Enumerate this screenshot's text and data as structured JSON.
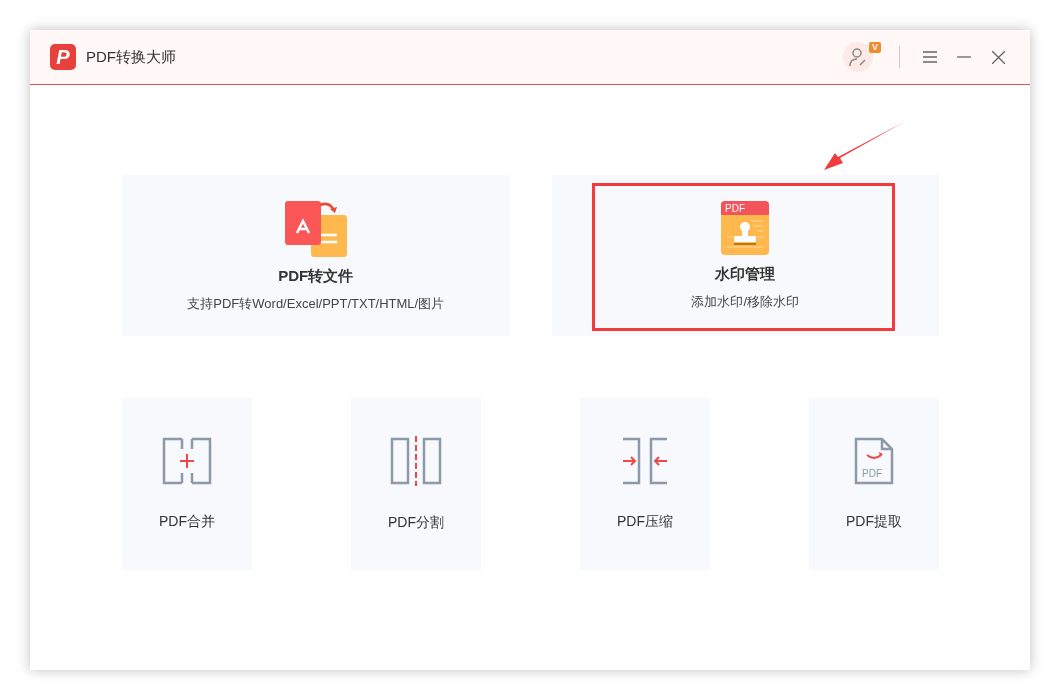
{
  "window": {
    "title": "PDF转换大师",
    "logo_letter": "P",
    "badge": "V"
  },
  "features": [
    {
      "kind": "convert",
      "title": "PDF转文件",
      "subtitle": "支持PDF转Word/Excel/PPT/TXT/HTML/图片",
      "highlighted": false
    },
    {
      "kind": "watermark",
      "title": "水印管理",
      "subtitle": "添加水印/移除水印",
      "icon_text": "PDF",
      "highlighted": true
    }
  ],
  "tools": [
    {
      "kind": "merge",
      "label": "PDF合并"
    },
    {
      "kind": "split",
      "label": "PDF分割"
    },
    {
      "kind": "compress",
      "label": "PDF压缩"
    },
    {
      "kind": "extract",
      "label": "PDF提取",
      "icon_text": "PDF"
    }
  ],
  "annotation": {
    "arrow": true
  }
}
